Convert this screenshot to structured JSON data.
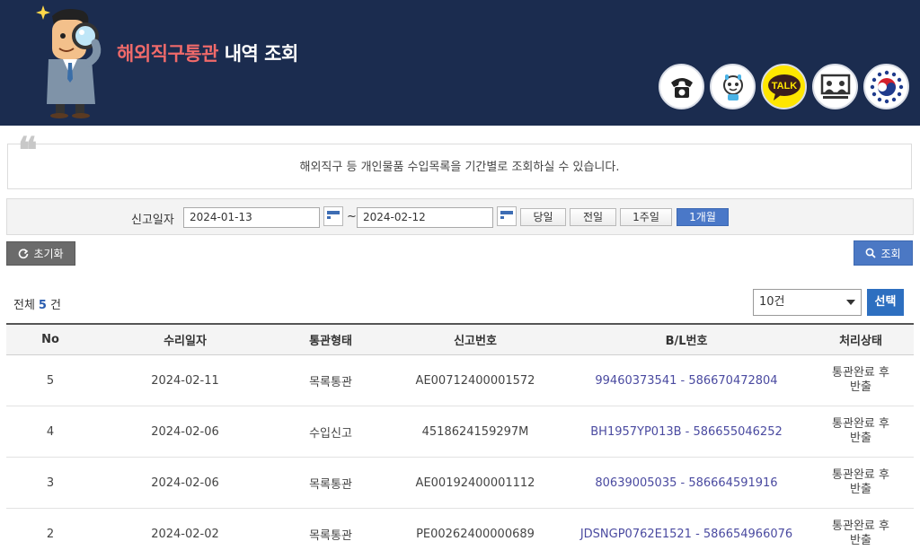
{
  "header": {
    "title_accent": "해외직구통관",
    "title_rest": " 내역 조회",
    "icons": [
      "phone-icon",
      "chatbot-icon",
      "kakao-talk-icon",
      "presentation-icon",
      "gov-emblem-icon"
    ],
    "talk_label": "TALK"
  },
  "info": {
    "quote": "❝",
    "text": "해외직구 등 개인물품 수입목록을 기간별로 조회하실 수 있습니다."
  },
  "filter": {
    "label": "신고일자",
    "start_date": "2024-01-13",
    "end_date": "2024-02-12",
    "tilde": "~",
    "quick_buttons": [
      "당일",
      "전일",
      "1주일",
      "1개월"
    ],
    "active_quick": "1개월"
  },
  "actions": {
    "reset_label": "초기화",
    "search_label": "조회"
  },
  "summary": {
    "total_label": "전체",
    "total_count": "5",
    "total_unit": "건",
    "page_size": "10건",
    "select_label": "선택"
  },
  "table": {
    "headers": [
      "No",
      "수리일자",
      "통관형태",
      "신고번호",
      "B/L번호",
      "처리상태"
    ],
    "rows": [
      {
        "no": "5",
        "date": "2024-02-11",
        "type": "목록통관",
        "decl": "AE00712400001572",
        "bl": "99460373541 - 586670472804",
        "status": "통관완료 후\n반출"
      },
      {
        "no": "4",
        "date": "2024-02-06",
        "type": "수입신고",
        "decl": "4518624159297M",
        "bl": "BH1957YP013B - 586655046252",
        "status": "통관완료 후\n반출"
      },
      {
        "no": "3",
        "date": "2024-02-06",
        "type": "목록통관",
        "decl": "AE00192400001112",
        "bl": "80639005035 - 586664591916",
        "status": "통관완료 후\n반출"
      },
      {
        "no": "2",
        "date": "2024-02-02",
        "type": "목록통관",
        "decl": "PE00262400000689",
        "bl": "JDSNGP0762E1521 - 586654966076",
        "status": "통관완료 후\n반출"
      }
    ]
  },
  "colors": {
    "header_bg": "#1b2c4f",
    "title_accent": "#f06a6a",
    "primary_blue": "#4b78c4",
    "link_text": "#4a4aa0"
  }
}
